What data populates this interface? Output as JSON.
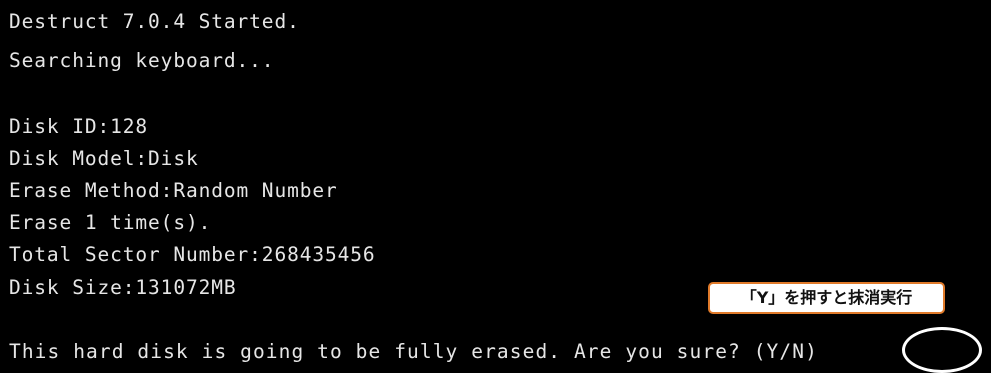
{
  "terminal": {
    "lines": [
      "Destruct 7.0.4 Started.",
      "Searching keyboard...",
      "",
      "Disk ID:128",
      "Disk Model:Disk",
      "Erase Method:Random Number",
      "Erase 1 time(s).",
      "Total Sector Number:268435456",
      "Disk Size:131072MB",
      "",
      "This hard disk is going to be fully erased. Are you sure? (Y/N)"
    ]
  },
  "annotation": {
    "callout_text": "「Y」を押すと抹消実行"
  },
  "colors": {
    "background": "#000000",
    "text": "#e6e6e6",
    "callout_border": "#e07a2a",
    "callout_background": "#ffffff",
    "highlight_ring": "#ffffff"
  }
}
